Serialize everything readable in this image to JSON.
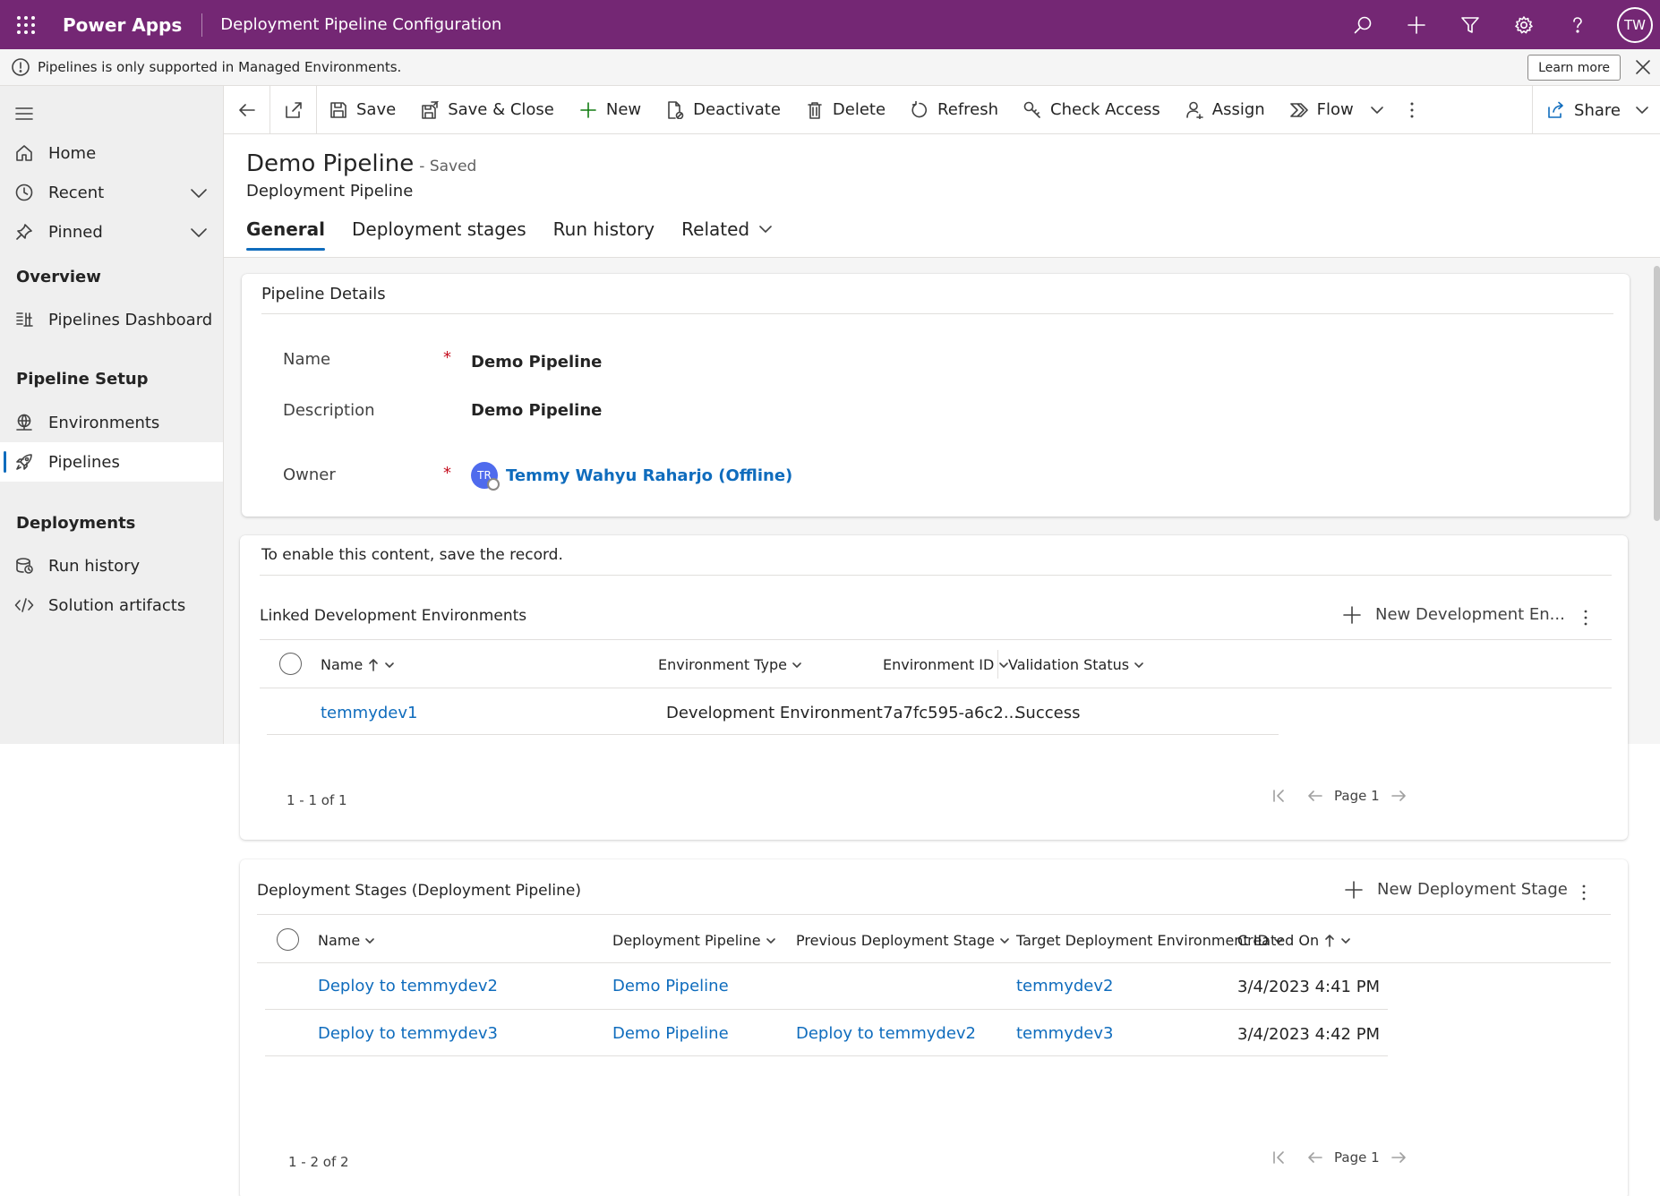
{
  "topbar": {
    "app_name": "Power Apps",
    "title": "Deployment Pipeline Configuration",
    "avatar_initials": "TW",
    "icons": [
      "search-icon",
      "add-icon",
      "filter-icon",
      "settings-icon",
      "help-icon"
    ]
  },
  "notification": {
    "message": "Pipelines is only supported in Managed Environments.",
    "learn_more": "Learn more"
  },
  "sidebar": {
    "items_top": [
      {
        "label": "Home",
        "icon": "home-icon"
      },
      {
        "label": "Recent",
        "icon": "clock-icon"
      },
      {
        "label": "Pinned",
        "icon": "pin-icon"
      }
    ],
    "overview_heading": "Overview",
    "overview_items": [
      {
        "label": "Pipelines Dashboard",
        "icon": "dashboard-icon"
      }
    ],
    "setup_heading": "Pipeline Setup",
    "setup_items": [
      {
        "label": "Environments",
        "icon": "globe-icon"
      },
      {
        "label": "Pipelines",
        "icon": "rocket-icon"
      }
    ],
    "deployments_heading": "Deployments",
    "deployments_items": [
      {
        "label": "Run history",
        "icon": "history-icon"
      },
      {
        "label": "Solution artifacts",
        "icon": "code-icon"
      }
    ]
  },
  "commandbar": {
    "save": "Save",
    "save_close": "Save & Close",
    "new": "New",
    "deactivate": "Deactivate",
    "delete": "Delete",
    "refresh": "Refresh",
    "check_access": "Check Access",
    "assign": "Assign",
    "flow": "Flow",
    "share": "Share"
  },
  "record": {
    "title": "Demo Pipeline",
    "status": "- Saved",
    "entity": "Deployment Pipeline",
    "tabs": [
      "General",
      "Deployment stages",
      "Run history",
      "Related"
    ]
  },
  "details": {
    "section_title": "Pipeline Details",
    "name_label": "Name",
    "name_value": "Demo Pipeline",
    "description_label": "Description",
    "description_value": "Demo Pipeline",
    "owner_label": "Owner",
    "owner_initials": "TR",
    "owner_value": "Temmy Wahyu Raharjo (Offline)",
    "required_mark": "*"
  },
  "linked": {
    "notice": "To enable this content, save the record.",
    "title": "Linked Development Environments",
    "new_button": "New Development En...",
    "columns": [
      "Name",
      "Environment Type",
      "Environment ID",
      "Validation Status"
    ],
    "rows": [
      {
        "name": "temmydev1",
        "type": "Development Environment",
        "id": "7a7fc595-a6c2...",
        "status": "Success"
      }
    ],
    "count": "1 - 1 of 1",
    "page": "Page 1"
  },
  "stages": {
    "title": "Deployment Stages (Deployment Pipeline)",
    "new_button": "New Deployment Stage",
    "columns": [
      "Name",
      "Deployment Pipeline",
      "Previous Deployment Stage",
      "Target Deployment Environment ID",
      "Created On"
    ],
    "rows": [
      {
        "name": "Deploy to temmydev2",
        "pipeline": "Demo Pipeline",
        "previous": "",
        "target": "temmydev2",
        "created": "3/4/2023 4:41 PM"
      },
      {
        "name": "Deploy to temmydev3",
        "pipeline": "Demo Pipeline",
        "previous": "Deploy to temmydev2",
        "target": "temmydev3",
        "created": "3/4/2023 4:42 PM"
      }
    ],
    "count": "1 - 2 of 2",
    "page": "Page 1"
  },
  "colors": {
    "brand": "#742774",
    "link": "#0f6cbd",
    "required": "#c50f1f"
  }
}
